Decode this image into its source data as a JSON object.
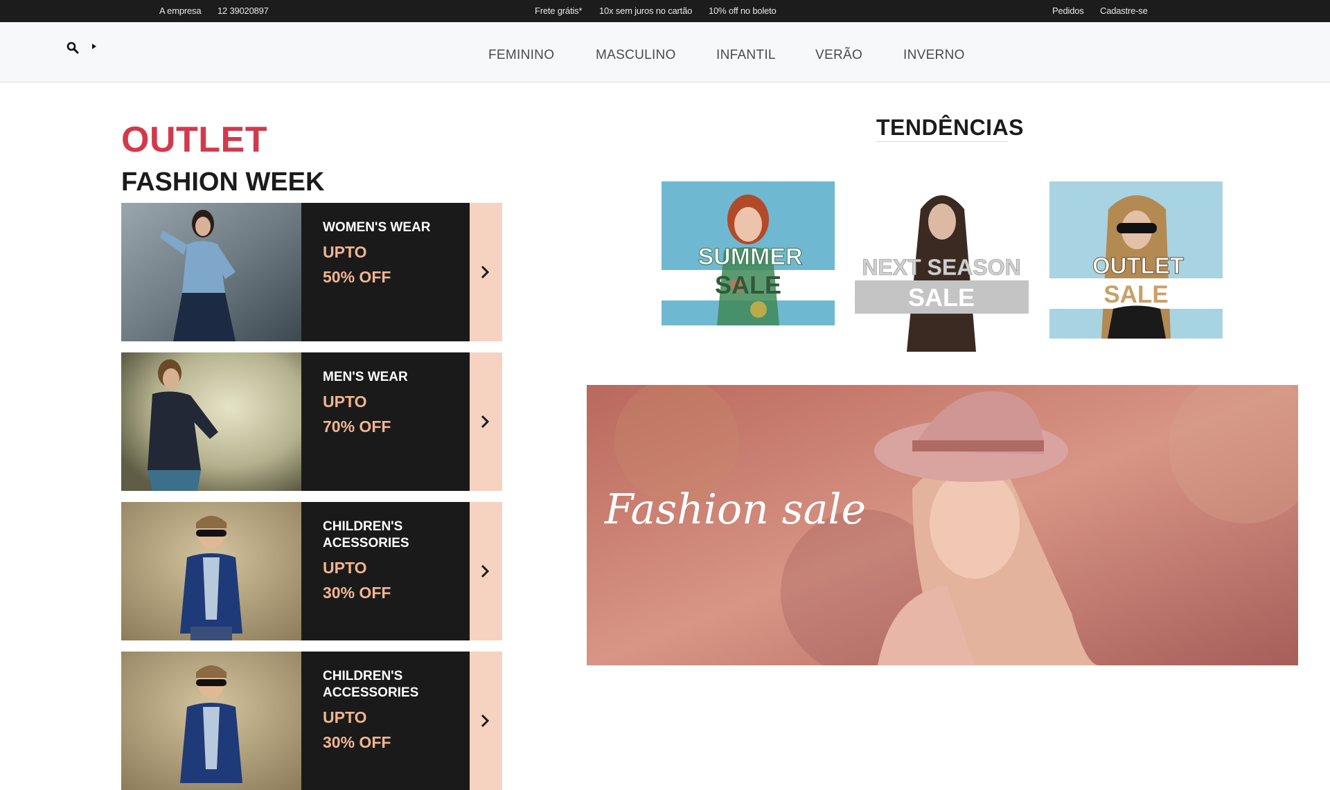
{
  "topbar": {
    "company": "A empresa",
    "phone": "12 39020897",
    "shipping": "Frete grátis*",
    "installments": "10x sem juros no cartão",
    "discount": "10% off no boleto",
    "orders": "Pedidos",
    "signup": "Cadastre-se"
  },
  "nav": {
    "items": [
      "FEMININO",
      "MASCULINO",
      "INFANTIL",
      "VERÃO",
      "INVERNO"
    ],
    "search_icon": "search-icon",
    "caret_icon": "caret-right-icon"
  },
  "left": {
    "outlet": "OUTLET",
    "fashion_week": "FASHION WEEK",
    "cards": [
      {
        "category": "WOMEN'S WEAR",
        "upto": "UPTO",
        "off": "50% OFF"
      },
      {
        "category": "MEN'S WEAR",
        "upto": "UPTO",
        "off": "70% OFF"
      },
      {
        "category": "CHILDREN'S ACESSORIES",
        "upto": "UPTO",
        "off": "30% OFF"
      },
      {
        "category": "CHILDREN'S ACCESSORIES",
        "upto": "UPTO",
        "off": "30% OFF"
      }
    ]
  },
  "right": {
    "trends_title": "TENDÊNCIAS",
    "trends": [
      {
        "line1": "SUMMER",
        "line2": "SALE"
      },
      {
        "line1": "NEXT SEASON",
        "line2": "SALE"
      },
      {
        "line1": "OUTLET",
        "line2": "SALE"
      }
    ],
    "banner_text": "Fashion sale"
  },
  "colors": {
    "topbar_bg": "#1c1c1c",
    "outlet_red": "#d23a4c",
    "card_dark": "#1a1a1a",
    "accent_peach": "#f1b590",
    "arrow_box": "#f5d3c0"
  }
}
